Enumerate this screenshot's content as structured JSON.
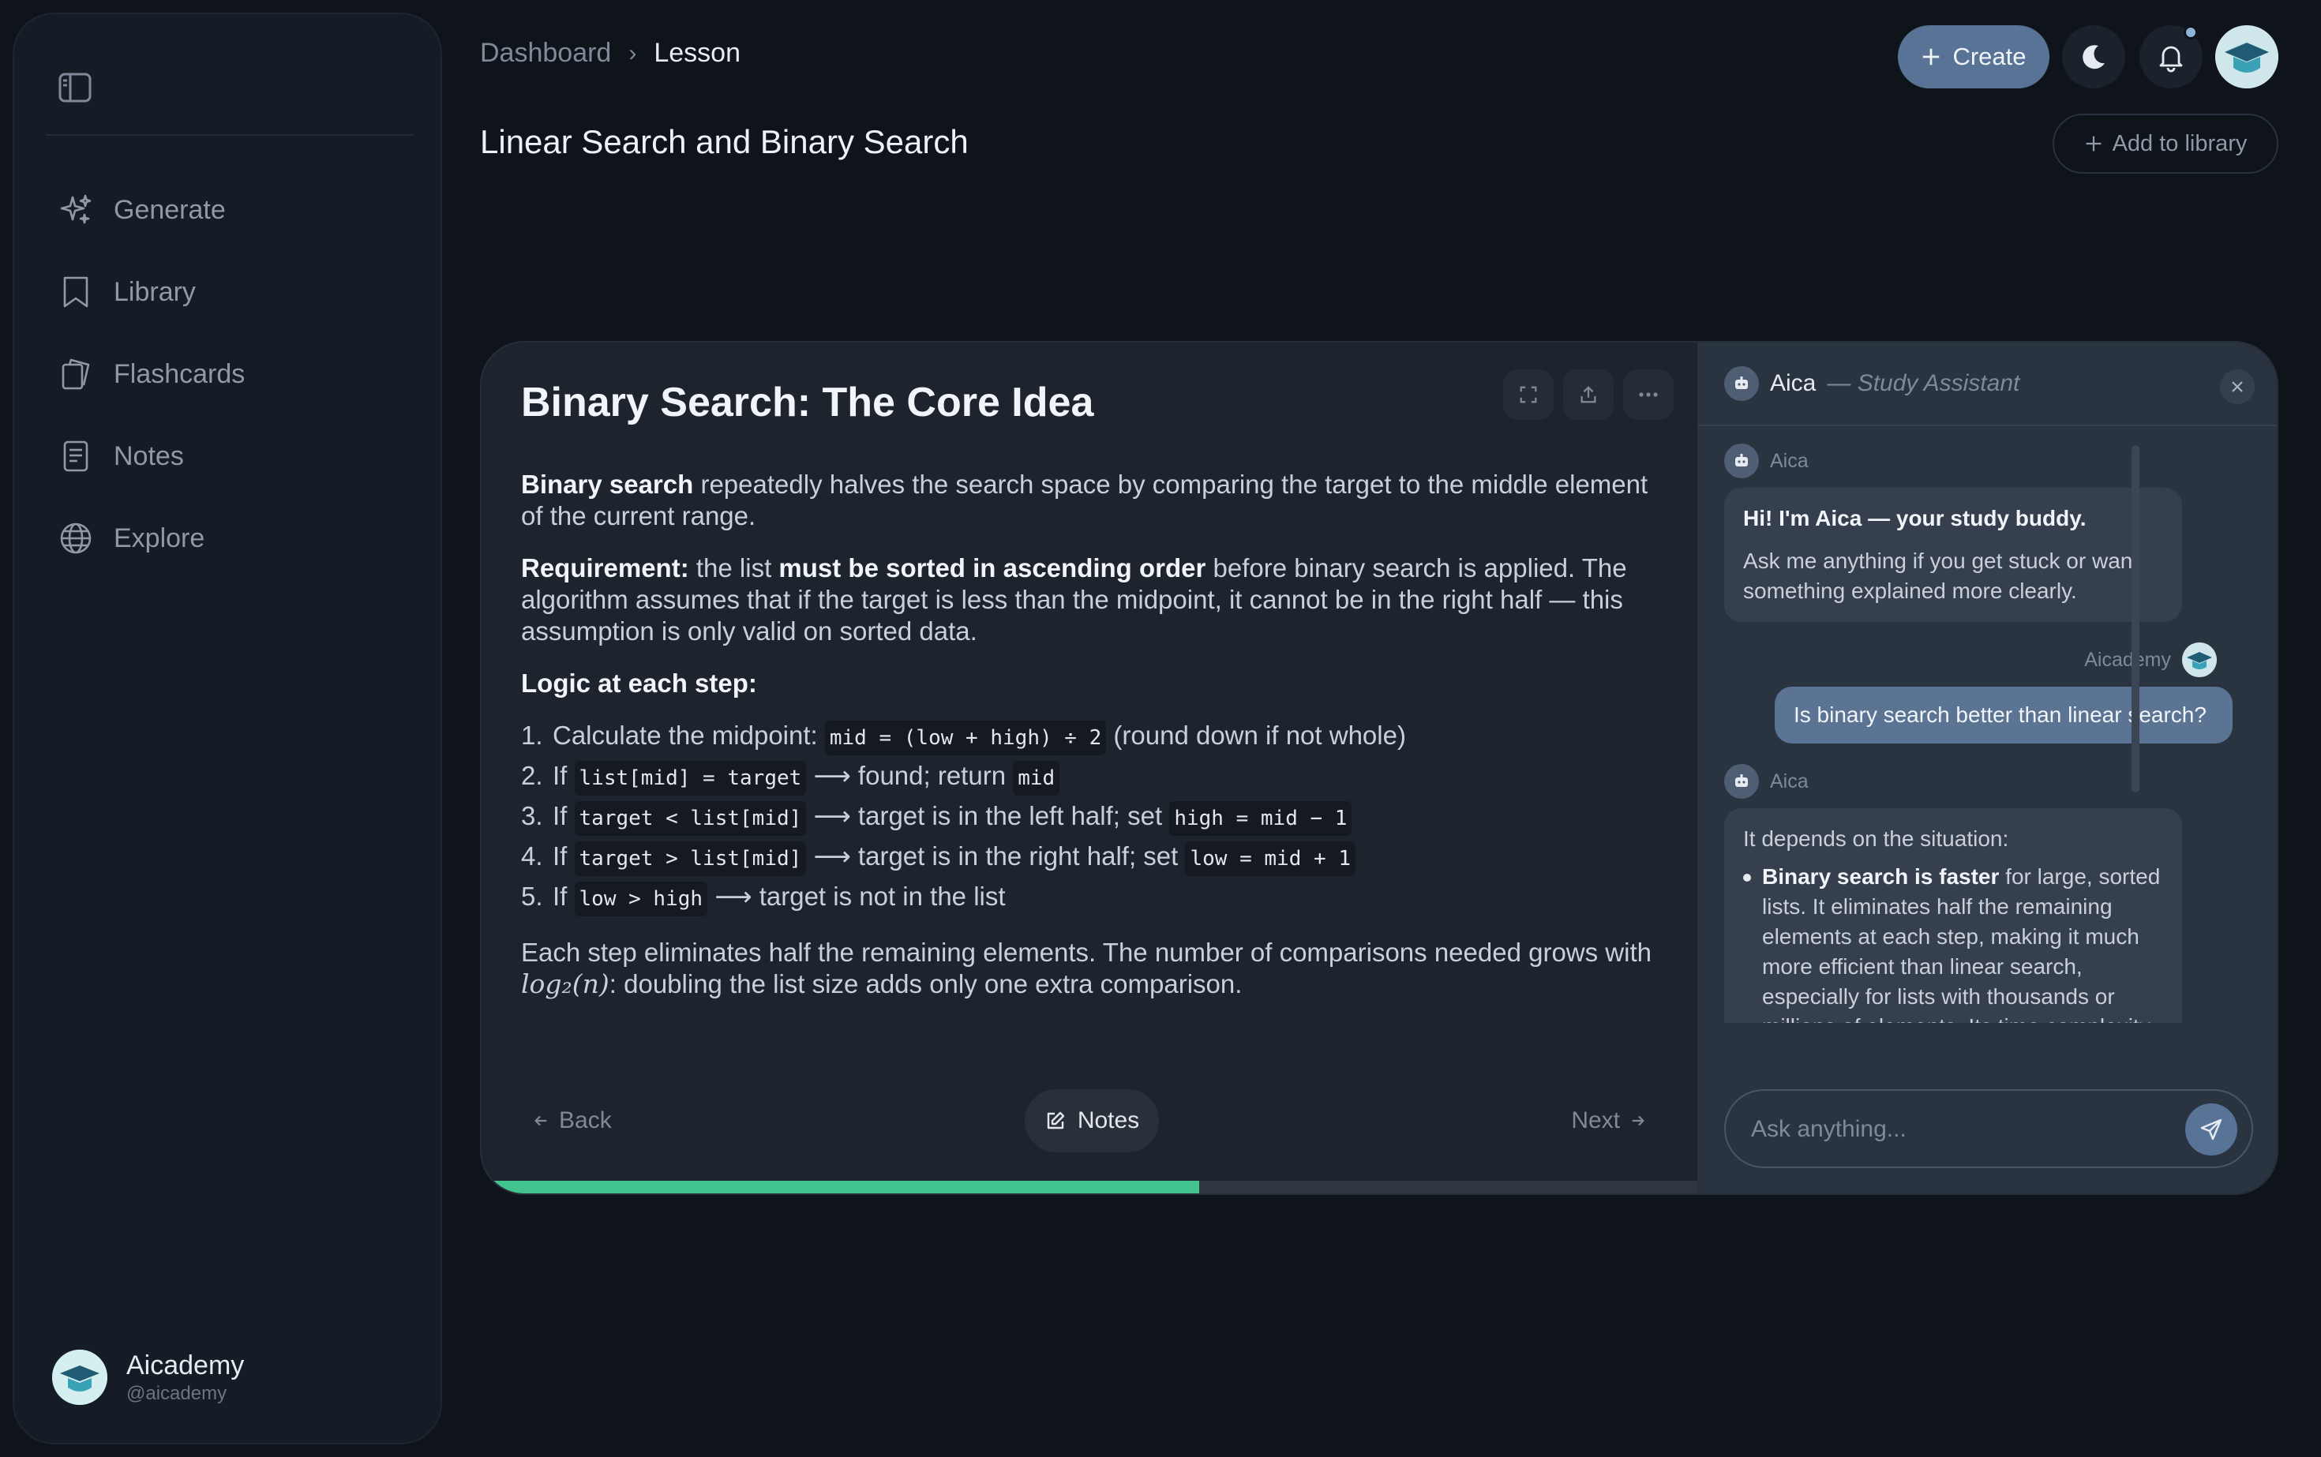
{
  "sidebar": {
    "items": [
      {
        "label": "Generate",
        "icon": "sparkles-icon"
      },
      {
        "label": "Library",
        "icon": "bookmark-icon"
      },
      {
        "label": "Flashcards",
        "icon": "cards-icon"
      },
      {
        "label": "Notes",
        "icon": "document-icon"
      },
      {
        "label": "Explore",
        "icon": "globe-icon"
      }
    ],
    "profile": {
      "name": "Aicademy",
      "handle": "@aicademy"
    }
  },
  "breadcrumb": {
    "parent": "Dashboard",
    "current": "Lesson",
    "separator": "›"
  },
  "page_title": "Linear Search and Binary Search",
  "header": {
    "create_label": "Create",
    "add_library_label": "Add to library"
  },
  "lesson": {
    "heading": "Binary Search: The Core Idea",
    "p1_bold": "Binary search",
    "p1_rest": " repeatedly halves the search space by comparing the target to the middle element of the current range.",
    "p2_bold1": "Requirement:",
    "p2_mid": " the list ",
    "p2_bold2": "must be sorted in ascending order",
    "p2_rest": " before binary search is applied. The algorithm assumes that if the target is less than the midpoint, it cannot be in the right half — this assumption is only valid on sorted data.",
    "logic_heading": "Logic at each step:",
    "steps": [
      {
        "num": "1.",
        "t1": "Calculate the midpoint: ",
        "c1": "mid = (low + high) ÷ 2",
        "t2": " (round down if not whole)",
        "c2": "",
        "t3": "",
        "c3": ""
      },
      {
        "num": "2.",
        "t1": "If ",
        "c1": "list[mid] = target",
        "t2": " ⟶ found; return ",
        "c2": "mid",
        "t3": "",
        "c3": ""
      },
      {
        "num": "3.",
        "t1": "If ",
        "c1": "target < list[mid]",
        "t2": " ⟶ target is in the left half; set ",
        "c2": "high = mid − 1",
        "t3": "",
        "c3": ""
      },
      {
        "num": "4.",
        "t1": "If ",
        "c1": "target > list[mid]",
        "t2": " ⟶ target is in the right half; set ",
        "c2": "low = mid + 1",
        "t3": "",
        "c3": ""
      },
      {
        "num": "5.",
        "t1": "If ",
        "c1": "low > high",
        "t2": " ⟶ target is not in the list",
        "c2": "",
        "t3": "",
        "c3": ""
      }
    ],
    "p3_a": "Each step eliminates half the remaining elements. The number of comparisons needed grows with ",
    "p3_math": "log₂(n)",
    "p3_b": ": doubling the list size adds only one extra comparison.",
    "back_label": "Back",
    "notes_label": "Notes",
    "next_label": "Next",
    "progress": 0.59
  },
  "chat": {
    "title": "Aica",
    "subtitle": "— Study Assistant",
    "messages": {
      "bot1_sender": "Aica",
      "bot1_bold": "Hi! I'm Aica — your study buddy.",
      "bot1_text": "Ask me anything if you get stuck or want something explained more clearly.",
      "user_sender": "Aicademy",
      "user_text": "Is binary search better than linear search?",
      "bot2_sender": "Aica",
      "bot2_intro": "It depends on the situation:",
      "bot2_bullet_bold": "Binary search is faster",
      "bot2_bullet_text": " for large, sorted lists. It eliminates half the remaining elements at each step, making it much more efficient than linear search, especially for lists with thousands or millions of elements. Its time complexity is O(log n)."
    },
    "input_placeholder": "Ask anything..."
  },
  "colors": {
    "accent": "#587395",
    "progress": "#43c38d",
    "background": "#0f141b"
  }
}
